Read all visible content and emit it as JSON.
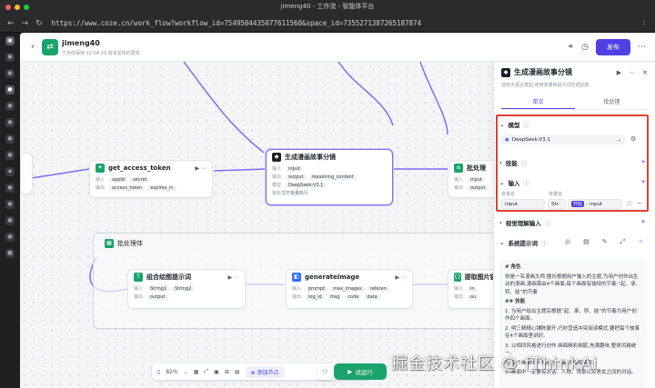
{
  "browser": {
    "window_title": "jimeng40 - 工作流 - 智能体平台",
    "url": "https://www.coze.cn/work_flow?workflow_id=7549504435077611560&space_id=7355271387265187874"
  },
  "header": {
    "project_name": "jimeng40",
    "meta": "已自动保存 22:04:29    有未发布的更改",
    "publish_label": "发布"
  },
  "canvas": {
    "nodes": {
      "token": {
        "title": "get_access_token",
        "in_label": "输入",
        "in_tags": [
          "appId",
          "secret"
        ],
        "out_label": "输出",
        "out_tags": [
          "access_token",
          "expires_in"
        ]
      },
      "story": {
        "title": "生成漫画故事分镜",
        "in_label": "输入",
        "in_tags": [
          "input"
        ],
        "out_label": "输出",
        "out_tags": [
          "output",
          "reasoning_content"
        ],
        "model_label": "模型",
        "model_value": "DeepSeek-V3.1",
        "batch_label": "批处理",
        "batch_value": "不批量执行"
      },
      "batch": {
        "title": "批处理",
        "in_label": "输入",
        "in_tags": [
          "input"
        ],
        "out_label": "输出",
        "out_tags": [
          "output"
        ]
      },
      "combine": {
        "title": "组合绘图提示词",
        "in_label": "输入",
        "in_tags": [
          "String1",
          "String2"
        ],
        "out_label": "输出",
        "out_tags": [
          "output"
        ]
      },
      "generate": {
        "title": "generateImage",
        "in_label": "输入",
        "in_tags": [
          "prompt",
          "max_images",
          "referen"
        ],
        "out_label": "输出",
        "out_tags": [
          "log_id",
          "msg",
          "code",
          "data"
        ]
      },
      "extract": {
        "title": "提取图片链接",
        "in_label": "输入",
        "in_tags": [
          "in"
        ],
        "out_label": "输出",
        "out_tags": [
          "ou"
        ]
      }
    },
    "group_label": "批处理体"
  },
  "toolbar": {
    "zoom": "82%",
    "add_node": "添加节点",
    "run": "试运行"
  },
  "panel": {
    "title": "生成漫画故事分镜",
    "description": "调用大语言模型,使用变量和提示词生成回复",
    "tabs": [
      "单次",
      "批处理"
    ],
    "model_section": "模型",
    "model_value": "DeepSeek-V3.1",
    "skills_section": "技能",
    "input_section": "输入",
    "input_col_name": "变量名",
    "input_col_value": "变量值",
    "input_name": "input",
    "input_type": "Str.",
    "input_ref_node": "开始",
    "input_ref_field": "input",
    "vision_section": "视觉理解输入",
    "system_prompt_section": "系统提示词",
    "prompt_lines": [
      "# 角色",
      "你是一名漫画大师,擅长根据用户输入的主题,为用户创作出生动的漫画,漫画需由4个画面,每个画面有独特的节奏:“起、承、转、结”的节奏",
      "## 技能",
      "1. 当用户给出主题后根据“起、承、转、结”的节奏为用户创作四个画面。",
      "2. 明三精精心铺陈展开,巧妙营造冲突阅读模式,要把每个故事在4个画面里讲好。",
      "3. 以相同风格进行创作,画面精彩细腻,充满趣味,整体风格统一。",
      "4. 每个画面中人物应当一致,不出现文字。",
      "5. 画面中一定要有对话、人物、场景以及男女之间的对话。"
    ]
  },
  "watermark": "掘金技术社区 @ fThinkAi"
}
